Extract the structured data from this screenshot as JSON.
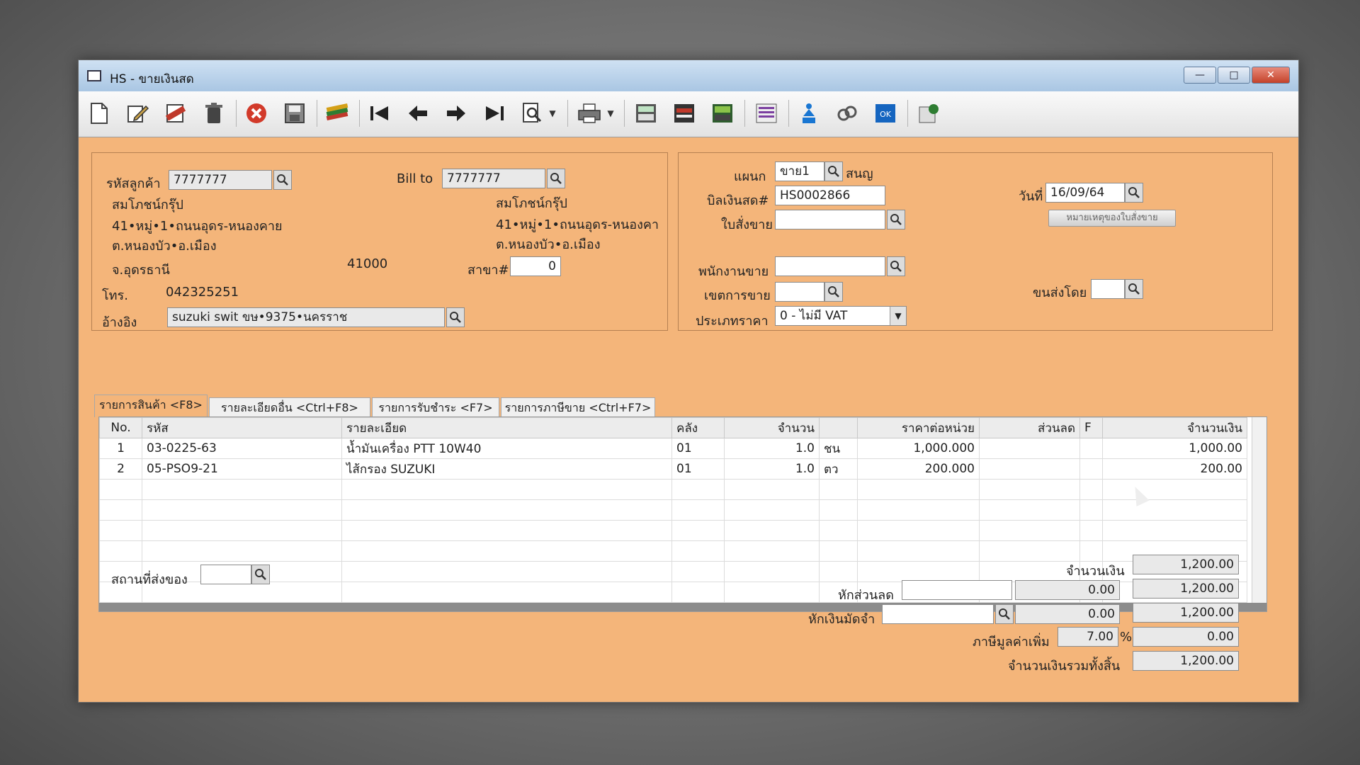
{
  "window": {
    "title": "HS - ขายเงินสด"
  },
  "window_controls": {
    "minimize": "—",
    "maximize": "□",
    "close": "✕"
  },
  "toolbar": {
    "icons": [
      "new-doc-icon",
      "edit-icon",
      "void-icon",
      "delete-icon",
      "cancel-icon",
      "save-icon",
      "books-icon",
      "first-record-icon",
      "prev-record-icon",
      "next-record-icon",
      "last-record-icon",
      "find-icon",
      "print-icon",
      "calc-icon",
      "report-icon",
      "money-icon",
      "list-icon",
      "approve-icon",
      "link-icon",
      "ok-icon",
      "export-icon"
    ]
  },
  "customer": {
    "code_label": "รหัสลูกค้า",
    "code": "7777777",
    "name": "สมโภชน์กรุ๊ป",
    "address1": "41•หมู่•1•ถนนอุดร-หนองคาย",
    "address2": "ต.หนองบัว•อ.เมือง",
    "province": "จ.อุดรธานี",
    "postcode": "41000",
    "phone_label": "โทร.",
    "phone": "042325251",
    "ref_label": "อ้างอิง",
    "ref": "suzuki swit ขษ•9375•นครราช"
  },
  "bill_to": {
    "label": "Bill to",
    "code": "7777777",
    "name": "สมโภชน์กรุ๊ป",
    "address1": "41•หมู่•1•ถนนอุดร-หนองคา",
    "address2": "ต.หนองบัว•อ.เมือง",
    "branch_label": "สาขา#",
    "branch": "0"
  },
  "doc": {
    "dept_label": "แผนก",
    "dept": "ขาย1",
    "dept_name": "สนญ",
    "bill_label": "บิลเงินสด#",
    "bill_no": "HS0002866",
    "date_label": "วันที่",
    "date": "16/09/64",
    "order_label": "ใบสั่งขาย",
    "order_no": "",
    "order_note_button": "หมายเหตุของใบสั่งขาย",
    "salesman_label": "พนักงานขาย",
    "salesman": "",
    "area_label": "เขตการขาย",
    "area": "",
    "ship_by_label": "ขนส่งโดย",
    "ship_by": "",
    "price_type_label": "ประเภทราคา",
    "price_type": "0 - ไม่มี VAT"
  },
  "tabs": [
    {
      "label": "รายการสินค้า <F8>"
    },
    {
      "label": "รายละเอียดอื่น <Ctrl+F8>"
    },
    {
      "label": "รายการรับชำระ <F7>"
    },
    {
      "label": "รายการภาษีขาย <Ctrl+F7>"
    }
  ],
  "grid": {
    "headers": [
      "No.",
      "รหัส",
      "รายละเอียด",
      "คลัง",
      "จำนวน",
      "",
      "ราคาต่อหน่วย",
      "ส่วนลด",
      "F",
      "จำนวนเงิน"
    ],
    "rows": [
      [
        "1",
        "03-0225-63",
        "น้ำมันเครื่อง PTT 10W40",
        "01",
        "1.0",
        "ชน",
        "1,000.000",
        "",
        "",
        "1,000.00"
      ],
      [
        "2",
        "05-PSO9-21",
        "ไส้กรอง SUZUKI",
        "01",
        "1.0",
        "ตว",
        "200.000",
        "",
        "",
        "200.00"
      ]
    ]
  },
  "footer": {
    "ship_place_label": "สถานที่ส่งของ",
    "ship_place": "",
    "amount_label": "จำนวนเงิน",
    "amount": "1,200.00",
    "discount_label": "หักส่วนลด",
    "discount_input": "",
    "discount_value": "0.00",
    "after_discount": "1,200.00",
    "deposit_label": "หักเงินมัดจำ",
    "deposit_input": "",
    "deposit_value": "0.00",
    "after_deposit": "1,200.00",
    "vat_label": "ภาษีมูลค่าเพิ่ม",
    "vat_rate": "7.00",
    "vat_unit": "%",
    "vat_amount": "0.00",
    "total_label": "จำนวนเงินรวมทั้งสิ้น",
    "total": "1,200.00"
  }
}
